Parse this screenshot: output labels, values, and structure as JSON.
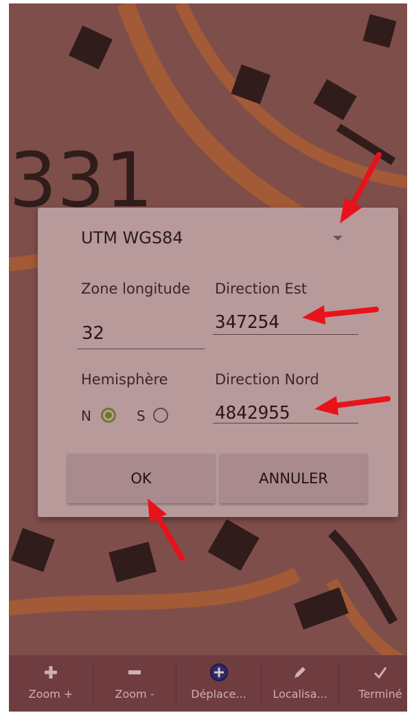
{
  "dialog": {
    "system": "UTM WGS84",
    "zone_label": "Zone longitude",
    "zone_value": "32",
    "east_label": "Direction Est",
    "east_value": "347254",
    "hemisphere_label": "Hemisphère",
    "hemi_n": "N",
    "hemi_s": "S",
    "north_label": "Direction Nord",
    "north_value": "4842955",
    "ok": "OK",
    "cancel": "ANNULER"
  },
  "toolbar": {
    "zoom_in": "Zoom +",
    "zoom_out": "Zoom -",
    "move": "Déplace...",
    "locate": "Localisa...",
    "done": "Terminé"
  },
  "colors": {
    "accent_radio": "#6b7a2b",
    "annotation_arrow": "#e8131a",
    "dialog_bg": "#b89a9b"
  }
}
